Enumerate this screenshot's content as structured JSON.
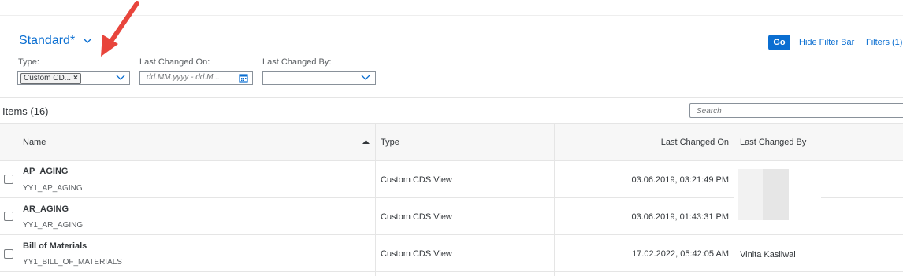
{
  "variant": {
    "title": "Standard*"
  },
  "actions": {
    "go": "Go",
    "hide_filter_bar": "Hide Filter Bar",
    "filters": "Filters (1)"
  },
  "filters": {
    "type": {
      "label": "Type:",
      "token": "Custom CD...",
      "token_remove": "×"
    },
    "last_changed_on": {
      "label": "Last Changed On:",
      "placeholder": "dd.MM.yyyy - dd.M..."
    },
    "last_changed_by": {
      "label": "Last Changed By:",
      "value": ""
    }
  },
  "table": {
    "title": "Items (16)",
    "search_placeholder": "Search",
    "columns": {
      "name": "Name",
      "type": "Type",
      "last_changed_on": "Last Changed On",
      "last_changed_by": "Last Changed By"
    },
    "rows": [
      {
        "name": "AP_AGING",
        "id": "YY1_AP_AGING",
        "type": "Custom CDS View",
        "changed_on": "03.06.2019, 03:21:49 PM",
        "changed_by": ""
      },
      {
        "name": "AR_AGING",
        "id": "YY1_AR_AGING",
        "type": "Custom CDS View",
        "changed_on": "03.06.2019, 01:43:31 PM",
        "changed_by": ""
      },
      {
        "name": "Bill of Materials",
        "id": "YY1_BILL_OF_MATERIALS",
        "type": "Custom CDS View",
        "changed_on": "17.02.2022, 05:42:05 AM",
        "changed_by": "Vinita Kasliwal"
      }
    ]
  },
  "colors": {
    "accent": "#0a6ed1",
    "annotation_arrow": "#e8453c"
  },
  "icons": {
    "variant_chevron": "chevron-down-icon",
    "calendar": "calendar-icon",
    "sort": "sort-ascending-icon",
    "arrow": "red-arrow-annotation"
  }
}
